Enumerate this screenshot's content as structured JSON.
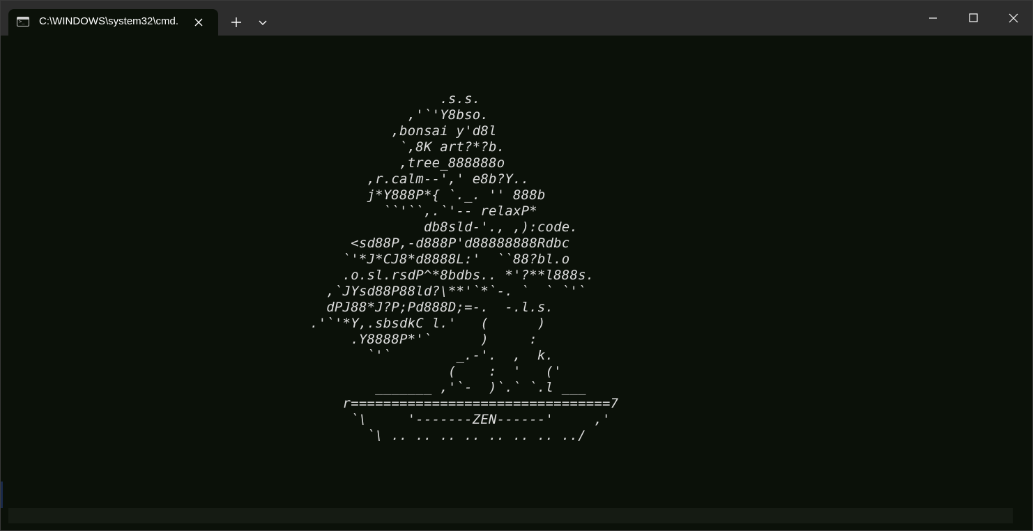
{
  "window": {
    "tab_title": "C:\\WINDOWS\\system32\\cmd.",
    "tab_icon": "terminal-icon",
    "new_tab_label": "+",
    "close_tab_label": "✕",
    "caption_buttons": [
      "minimize-icon",
      "maximize-icon",
      "close-icon"
    ]
  },
  "terminal": {
    "background": "#0b1109",
    "foreground": "#dcdcdc",
    "ascii_lines": [
      "                .s.s.",
      "            ,'`'Y8bso.",
      "          ,bonsai y'd8l",
      "           `,8K art?*?b.",
      "           ,tree_888888o",
      "       ,r.calm--',' e8b?Y..",
      "       j*Y888P*{ `._. '' 888b",
      "         ``'``,.`'-- relaxP*",
      "              db8sld-'., ,):code.",
      "     <sd88P,-d888P'd88888888Rdbc",
      "    `'*J*CJ8*d8888L:'  ``88?bl.o",
      "    .o.sl.rsdP^*8bdbs.. *'?**l888s.",
      "  ,`JYsd88P88ld?\\**'`*`-. `  ` `'`",
      "  dPJ88*J?P;Pd888D;=-.  -.l.s.",
      ".'`'*Y,.sbsdkC l.'   (      )",
      "     .Y8888P*'`      )     :",
      "       `'`        _.-'.  ,  k.",
      "                 (    :  '   ('",
      "        _______ ,'`-  )`.` `.l ___",
      "    r================================7",
      "     `\\     '-------ZEN------'     ,'",
      "       `\\ .. .. .. .. .. .. .. ../"
    ]
  }
}
